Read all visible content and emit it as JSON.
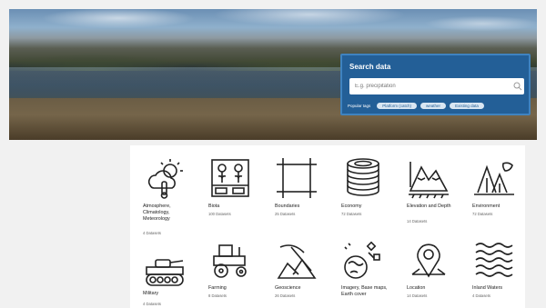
{
  "search": {
    "title": "Search data",
    "placeholder": "E.g. precipitation",
    "popular_label": "Popular tags",
    "tags": [
      "Platform (catch)",
      "weather",
      "Existing data"
    ]
  },
  "categories": [
    {
      "name": "Atmosphere, Climatology, Meteorology",
      "count": "4 Datasets",
      "icon": "weather-sun-cloud-icon"
    },
    {
      "name": "Biota",
      "count": "100 Datasets",
      "icon": "biota-plants-icon"
    },
    {
      "name": "Boundaries",
      "count": "25 Datasets",
      "icon": "boundaries-square-icon"
    },
    {
      "name": "Economy",
      "count": "72 Datasets",
      "icon": "coins-stack-icon"
    },
    {
      "name": "Elevation and Depth",
      "count": "14 Datasets",
      "icon": "elevation-mountains-icon"
    },
    {
      "name": "Environment",
      "count": "72 Datasets",
      "icon": "environment-trees-icon"
    },
    {
      "name": "Military",
      "count": "4 Datasets",
      "icon": "tank-icon"
    },
    {
      "name": "Farming",
      "count": "8 Datasets",
      "icon": "tractor-icon"
    },
    {
      "name": "Geoscience",
      "count": "26 Datasets",
      "icon": "pickaxe-rock-icon"
    },
    {
      "name": "Imagery, Base maps, Earth cover",
      "count": "",
      "icon": "satellite-earth-icon"
    },
    {
      "name": "Location",
      "count": "14 Datasets",
      "icon": "map-pin-icon"
    },
    {
      "name": "Inland Waters",
      "count": "4 Datasets",
      "icon": "waves-icon"
    }
  ]
}
